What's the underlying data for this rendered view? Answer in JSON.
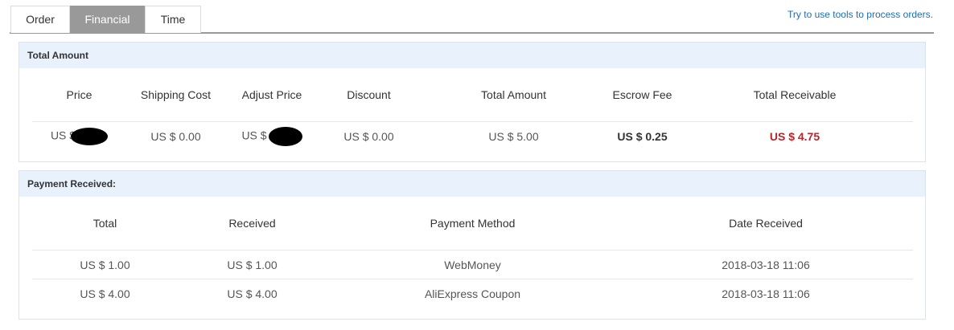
{
  "tabs": [
    {
      "label": "Order"
    },
    {
      "label": "Financial",
      "active": true
    },
    {
      "label": "Time"
    }
  ],
  "tools_link": "Try to use tools to process orders.",
  "total_amount": {
    "title": "Total Amount",
    "headers": [
      "Price",
      "Shipping Cost",
      "Adjust Price",
      "Discount",
      "Total Amount",
      "Escrow Fee",
      "Total Receivable"
    ],
    "row": {
      "price_prefix": "US $",
      "shipping_cost": "US $ 0.00",
      "adjust_prefix": "US $",
      "discount": "US $ 0.00",
      "total_amount": "US $ 5.00",
      "escrow_fee": "US $ 0.25",
      "total_receivable": "US $ 4.75"
    }
  },
  "payment": {
    "title": "Payment Received:",
    "headers": [
      "Total",
      "Received",
      "Payment Method",
      "Date Received"
    ],
    "rows": [
      [
        "US $ 1.00",
        "US $ 1.00",
        "WebMoney",
        "2018-03-18 11:06"
      ],
      [
        "US $ 4.00",
        "US $ 4.00",
        "AliExpress Coupon",
        "2018-03-18 11:06"
      ]
    ]
  },
  "colors": {
    "tab_active_bg": "#999999",
    "panel_header_bg": "#e9f1fd",
    "link": "#1a6fb5",
    "receivable": "#b8262c"
  }
}
